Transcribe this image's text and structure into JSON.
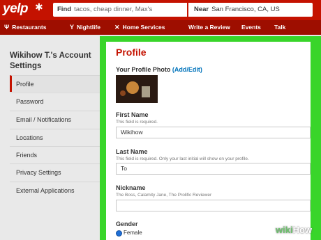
{
  "brand": {
    "logo": "yelp",
    "accent": "#c41200",
    "frame_color": "#39d52a"
  },
  "search": {
    "find_label": "Find",
    "find_value": "tacos, cheap dinner, Max's",
    "near_label": "Near",
    "near_value": "San Francisco, CA, US"
  },
  "nav": {
    "items": [
      {
        "label": "Restaurants",
        "icon": "fork-knife-icon"
      },
      {
        "label": "Nightlife",
        "icon": "cocktail-icon"
      },
      {
        "label": "Home Services",
        "icon": "tools-icon"
      },
      {
        "label": "Write a Review",
        "icon": ""
      },
      {
        "label": "Events",
        "icon": ""
      },
      {
        "label": "Talk",
        "icon": ""
      }
    ]
  },
  "sidebar": {
    "title": "Wikihow T.'s Account Settings",
    "items": [
      {
        "label": "Profile",
        "active": true
      },
      {
        "label": "Password"
      },
      {
        "label": "Email / Notifications"
      },
      {
        "label": "Locations"
      },
      {
        "label": "Friends"
      },
      {
        "label": "Privacy Settings"
      },
      {
        "label": "External Applications"
      }
    ]
  },
  "profile": {
    "title": "Profile",
    "photo_label": "Your Profile Photo",
    "photo_link": "(Add/Edit)",
    "first_name": {
      "label": "First Name",
      "help": "This field is required.",
      "value": "Wikihow"
    },
    "last_name": {
      "label": "Last Name",
      "help": "This field is required. Only your last initial will show on your profile.",
      "value": "To"
    },
    "nickname": {
      "label": "Nickname",
      "help": "The Boss, Calamity Jane, The Prolific Reviewer",
      "value": ""
    },
    "gender": {
      "label": "Gender",
      "option": "Female"
    }
  },
  "watermark": {
    "part1": "wiki",
    "part2": "How"
  }
}
